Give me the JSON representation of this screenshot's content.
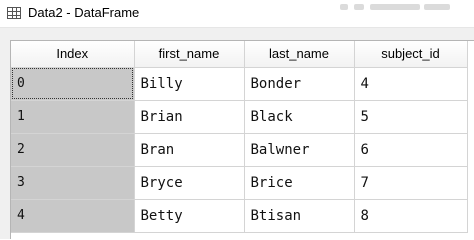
{
  "window": {
    "title": "Data2 - DataFrame"
  },
  "table": {
    "columns": [
      "Index",
      "first_name",
      "last_name",
      "subject_id"
    ],
    "rows": [
      {
        "index": "0",
        "first_name": "Billy",
        "last_name": "Bonder",
        "subject_id": "4"
      },
      {
        "index": "1",
        "first_name": "Brian",
        "last_name": "Black",
        "subject_id": "5"
      },
      {
        "index": "2",
        "first_name": "Bran",
        "last_name": "Balwner",
        "subject_id": "6"
      },
      {
        "index": "3",
        "first_name": "Bryce",
        "last_name": "Brice",
        "subject_id": "7"
      },
      {
        "index": "4",
        "first_name": "Betty",
        "last_name": "Btisan",
        "subject_id": "8"
      }
    ]
  }
}
